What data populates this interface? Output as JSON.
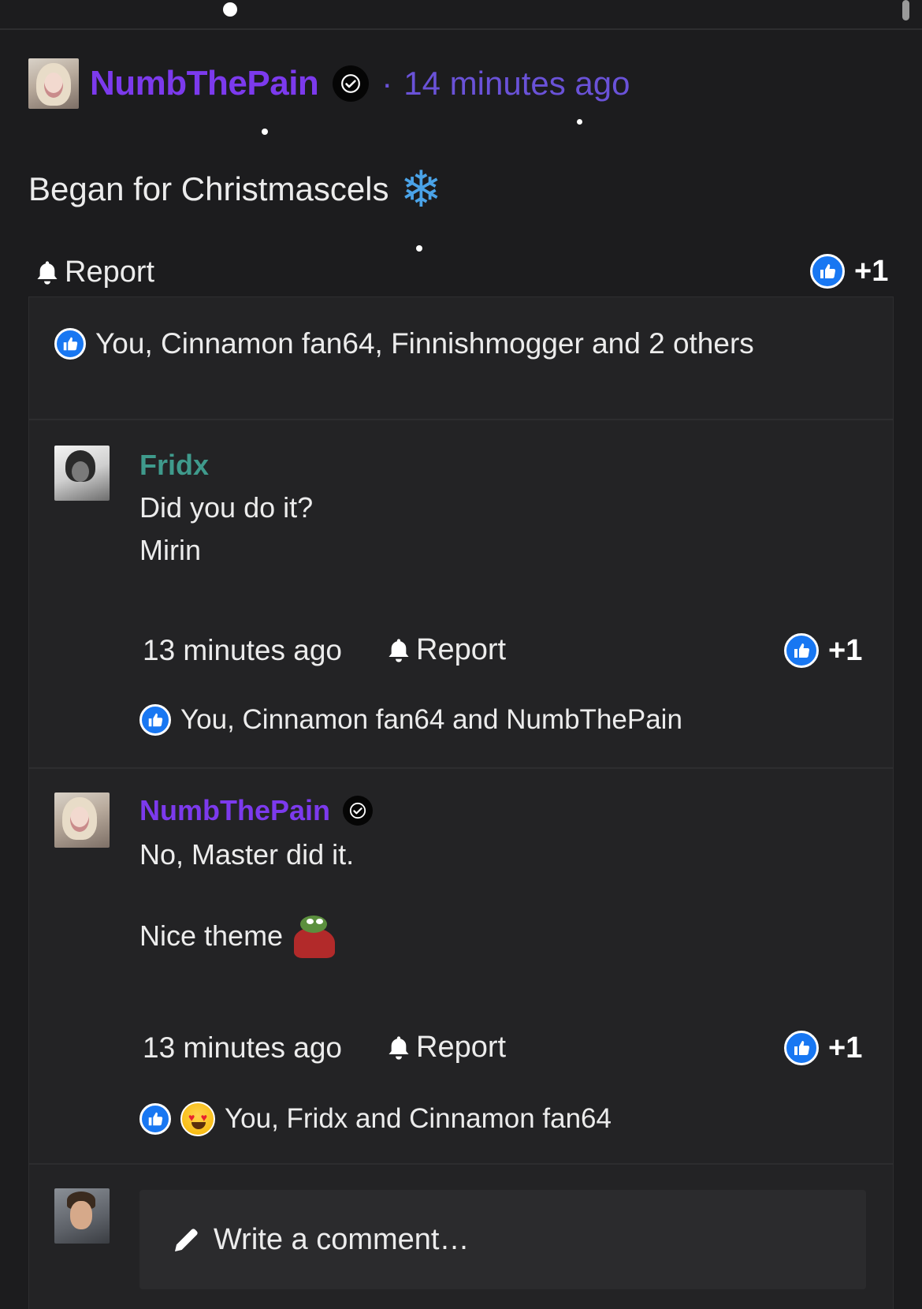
{
  "post": {
    "author": "NumbThePain",
    "separator": "·",
    "time": "14 minutes ago",
    "body": "Began for Christmascels",
    "body_emoji": "❄",
    "report_label": "Report",
    "like_count": "+1",
    "likes_summary": "You, Cinnamon fan64, Finnishmogger and 2 others"
  },
  "comments": [
    {
      "author": "Fridx",
      "lines": [
        "Did you do it?",
        "Mirin"
      ],
      "time": "13 minutes ago",
      "report_label": "Report",
      "like_count": "+1",
      "likes_summary": "You, Cinnamon fan64 and NumbThePain"
    },
    {
      "author": "NumbThePain",
      "lines": [
        "No, Master did it.",
        "Nice theme"
      ],
      "time": "13 minutes ago",
      "report_label": "Report",
      "like_count": "+1",
      "likes_summary": "You, Fridx and Cinnamon fan64"
    }
  ],
  "composer": {
    "placeholder": "Write a comment…"
  },
  "colors": {
    "background": "#1c1c1e",
    "username_purple": "#7c3aed",
    "username_teal": "#3f9a8c",
    "timestamp": "#6a52d8",
    "like_blue": "#1877f2"
  },
  "icons": [
    "verified-badge-icon",
    "bell-icon",
    "thumbs-up-icon",
    "love-eyes-emoji-icon",
    "pepe-blanket-emoji-icon",
    "pencil-icon",
    "snowflake-icon"
  ]
}
